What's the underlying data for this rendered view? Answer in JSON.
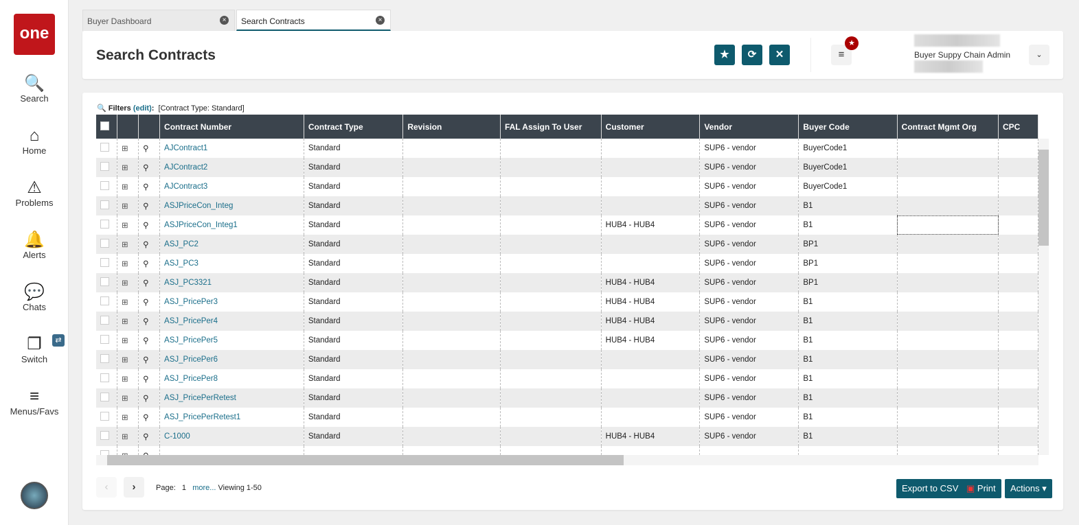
{
  "sidebar": {
    "logo": "one",
    "items": [
      {
        "label": "Search",
        "icon": "🔍"
      },
      {
        "label": "Home",
        "icon": "⌂"
      },
      {
        "label": "Problems",
        "icon": "⚠"
      },
      {
        "label": "Alerts",
        "icon": "🔔"
      },
      {
        "label": "Chats",
        "icon": "💬"
      },
      {
        "label": "Switch",
        "icon": "❐"
      },
      {
        "label": "Menus/Favs",
        "icon": "≡"
      }
    ]
  },
  "tabs": [
    {
      "label": "Buyer Dashboard"
    },
    {
      "label": "Search Contracts"
    }
  ],
  "header": {
    "title": "Search Contracts",
    "user_role": "Buyer Suppy Chain Admin"
  },
  "filters": {
    "label": "Filters",
    "edit": "(edit)",
    "colon": ":",
    "value": "[Contract Type: Standard]"
  },
  "columns": [
    "Contract Number",
    "Contract Type",
    "Revision",
    "FAL Assign To User",
    "Customer",
    "Vendor",
    "Buyer Code",
    "Contract Mgmt Org",
    "CPC"
  ],
  "rows": [
    [
      "AJContract1",
      "Standard",
      "",
      "",
      "",
      "SUP6 - vendor",
      "BuyerCode1",
      ""
    ],
    [
      "AJContract2",
      "Standard",
      "",
      "",
      "",
      "SUP6 - vendor",
      "BuyerCode1",
      ""
    ],
    [
      "AJContract3",
      "Standard",
      "",
      "",
      "",
      "SUP6 - vendor",
      "BuyerCode1",
      ""
    ],
    [
      "ASJPriceCon_Integ",
      "Standard",
      "",
      "",
      "",
      "SUP6 - vendor",
      "B1",
      ""
    ],
    [
      "ASJPriceCon_Integ1",
      "Standard",
      "",
      "",
      "HUB4 - HUB4",
      "SUP6 - vendor",
      "B1",
      ""
    ],
    [
      "ASJ_PC2",
      "Standard",
      "",
      "",
      "",
      "SUP6 - vendor",
      "BP1",
      ""
    ],
    [
      "ASJ_PC3",
      "Standard",
      "",
      "",
      "",
      "SUP6 - vendor",
      "BP1",
      ""
    ],
    [
      "ASJ_PC3321",
      "Standard",
      "",
      "",
      "HUB4 - HUB4",
      "SUP6 - vendor",
      "BP1",
      ""
    ],
    [
      "ASJ_PricePer3",
      "Standard",
      "",
      "",
      "HUB4 - HUB4",
      "SUP6 - vendor",
      "B1",
      ""
    ],
    [
      "ASJ_PricePer4",
      "Standard",
      "",
      "",
      "HUB4 - HUB4",
      "SUP6 - vendor",
      "B1",
      ""
    ],
    [
      "ASJ_PricePer5",
      "Standard",
      "",
      "",
      "HUB4 - HUB4",
      "SUP6 - vendor",
      "B1",
      ""
    ],
    [
      "ASJ_PricePer6",
      "Standard",
      "",
      "",
      "",
      "SUP6 - vendor",
      "B1",
      ""
    ],
    [
      "ASJ_PricePer8",
      "Standard",
      "",
      "",
      "",
      "SUP6 - vendor",
      "B1",
      ""
    ],
    [
      "ASJ_PricePerRetest",
      "Standard",
      "",
      "",
      "",
      "SUP6 - vendor",
      "B1",
      ""
    ],
    [
      "ASJ_PricePerRetest1",
      "Standard",
      "",
      "",
      "",
      "SUP6 - vendor",
      "B1",
      ""
    ],
    [
      "C-1000",
      "Standard",
      "",
      "",
      "HUB4 - HUB4",
      "SUP6 - vendor",
      "B1",
      ""
    ],
    [
      "",
      "",
      "",
      "",
      "",
      "",
      "",
      ""
    ]
  ],
  "pager": {
    "page_label": "Page:",
    "page": "1",
    "more": "more...",
    "viewing": "Viewing 1-50"
  },
  "buttons": {
    "export": "Export to CSV",
    "print": "Print",
    "actions": "Actions ▾"
  }
}
